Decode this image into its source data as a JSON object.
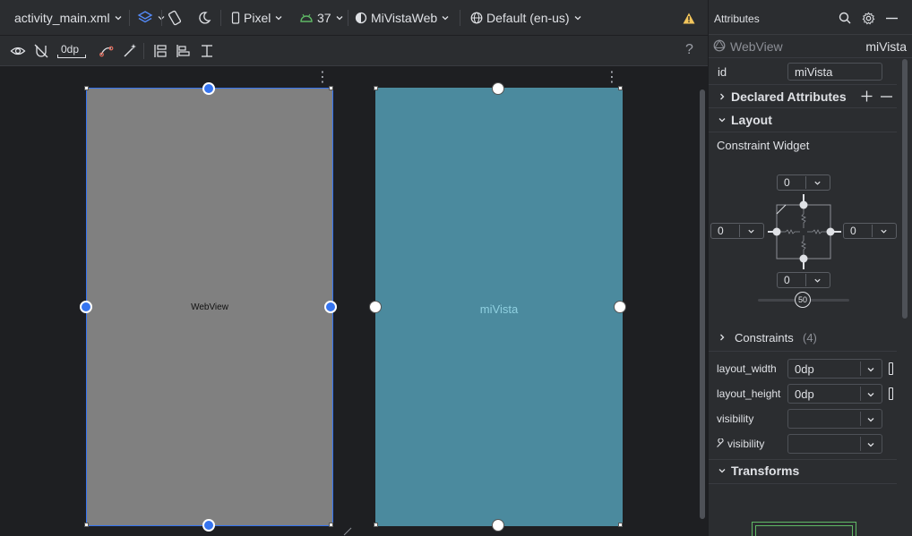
{
  "toolbar": {
    "file_name": "activity_main.xml",
    "device": "Pixel",
    "api_level": "37",
    "theme": "MiVistaWeb",
    "locale": "Default (en-us)"
  },
  "sub_toolbar": {
    "margin_value": "0dp",
    "help": "?"
  },
  "canvas": {
    "design_label": "WebView",
    "blueprint_label": "miVista",
    "menu_glyph": "⋮"
  },
  "attributes": {
    "panel_title": "Attributes",
    "widget_type": "WebView",
    "widget_id_display": "miVista",
    "id_label": "id",
    "id_value": "miVista",
    "declared_section": "Declared Attributes",
    "layout_section": "Layout",
    "constraint_widget_label": "Constraint Widget",
    "margins": {
      "top": "0",
      "left": "0",
      "right": "0",
      "bottom": "0"
    },
    "bias_value": "50",
    "constraints_section": "Constraints",
    "constraints_count": "(4)",
    "layout_width_label": "layout_width",
    "layout_width_value": "0dp",
    "layout_height_label": "layout_height",
    "layout_height_value": "0dp",
    "visibility_label": "visibility",
    "visibility_value": "",
    "tools_visibility_label": "visibility",
    "tools_visibility_value": "",
    "transforms_section": "Transforms"
  },
  "colors": {
    "selection_blue": "#3574f0",
    "design_gray": "#808080",
    "blueprint_teal": "#4b8a9e",
    "warning_yellow": "#f2c55c",
    "api_green": "#5fb865"
  }
}
